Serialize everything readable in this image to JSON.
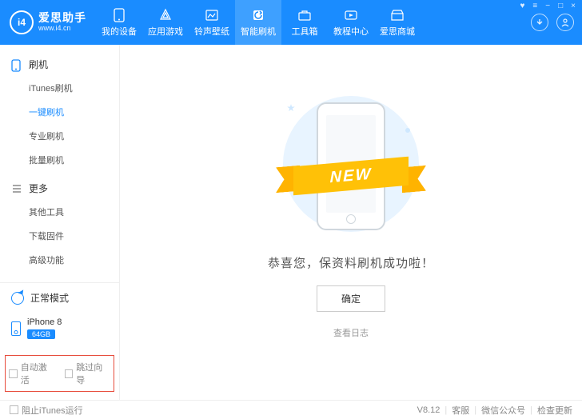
{
  "app": {
    "title": "爱思助手",
    "subtitle": "www.i4.cn",
    "logo_text": "i4"
  },
  "tabs": [
    {
      "label": "我的设备"
    },
    {
      "label": "应用游戏"
    },
    {
      "label": "铃声壁纸"
    },
    {
      "label": "智能刷机"
    },
    {
      "label": "工具箱"
    },
    {
      "label": "教程中心"
    },
    {
      "label": "爱思商城"
    }
  ],
  "sidebar": {
    "group1": {
      "title": "刷机",
      "items": [
        "iTunes刷机",
        "一键刷机",
        "专业刷机",
        "批量刷机"
      ]
    },
    "group2": {
      "title": "更多",
      "items": [
        "其他工具",
        "下载固件",
        "高级功能"
      ]
    },
    "mode": "正常模式",
    "device": {
      "name": "iPhone 8",
      "storage": "64GB"
    },
    "auto_activate": "自动激活",
    "skip_guide": "跳过向导"
  },
  "main": {
    "ribbon": "NEW",
    "message": "恭喜您，保资料刷机成功啦！",
    "ok": "确定",
    "log": "查看日志"
  },
  "footer": {
    "block_itunes": "阻止iTunes运行",
    "version": "V8.12",
    "support": "客服",
    "wechat": "微信公众号",
    "update": "检查更新"
  }
}
